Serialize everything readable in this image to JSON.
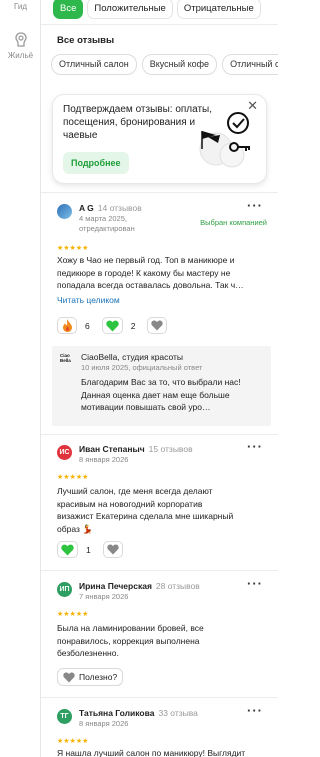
{
  "rail": {
    "guide_label": "Гид",
    "housing_label": "Жильё"
  },
  "filters": [
    "Все",
    "Положительные",
    "Отрицательные"
  ],
  "section": {
    "title": "Все отзывы",
    "tags": [
      "Отличный салон",
      "Вкусный кофе",
      "Отличный сер"
    ]
  },
  "promo": {
    "text": "Подтверждаем отзывы: оплаты, посещения, бронирования и чаевые",
    "button": "Подробнее",
    "close": "✕"
  },
  "reviews": [
    {
      "initials": "",
      "avatar_color": "#3b7dc4",
      "author": "A G",
      "count": "14 отзывов",
      "date": "4 марта 2025,",
      "date2": "отредактирован",
      "badge": "Выбран компанией",
      "stars": "★★★★★",
      "text": "Хожу в Чао не первый год. Топ в маникюре и педикюре в городе! К какому бы мастеру не попадала всегда оставалась довольна. Так ч…",
      "readmore": "Читать целиком",
      "reactions": [
        {
          "icon": "fire-icon",
          "count": "6"
        },
        {
          "icon": "green-heart-icon",
          "count": "2"
        },
        {
          "icon": "heart-outline-icon",
          "count": ""
        }
      ],
      "reply": {
        "logo": "Ciao Bella",
        "name": "CiaoBella, студия красоты",
        "date": "10 июля 2025, официальный ответ",
        "text": "Благодарим Вас за то, что выбрали нас! Данная оценка дает нам еще больше мотивации повышать свой уро…"
      }
    },
    {
      "initials": "ИС",
      "avatar_color": "#e0343c",
      "author": "Иван Степаныч",
      "count": "15 отзывов",
      "date": "8 января 2026",
      "stars": "★★★★★",
      "text": "Лучший салон, где меня всегда делают красивым на новогодний корпоратив визажист Екатерина сделала мне шикарный образ 💃",
      "reactions": [
        {
          "icon": "green-heart-icon",
          "count": "1"
        },
        {
          "icon": "heart-outline-icon",
          "count": ""
        }
      ]
    },
    {
      "initials": "ИП",
      "avatar_color": "#2f9e62",
      "author": "Ирина Печерская",
      "count": "28 отзывов",
      "date": "7 января 2026",
      "stars": "★★★★★",
      "text": "Была на ламинировании бровей, все понравилось, коррекция выполнена безболезненно.",
      "useful": "Полезно?"
    },
    {
      "initials": "ТГ",
      "avatar_color": "#2f9e62",
      "author": "Татьяна Голикова",
      "count": "33 отзыва",
      "date": "8 января 2026",
      "stars": "★★★★★",
      "text": "Я нашла лучший салон по маникюру! Выглядит"
    }
  ]
}
